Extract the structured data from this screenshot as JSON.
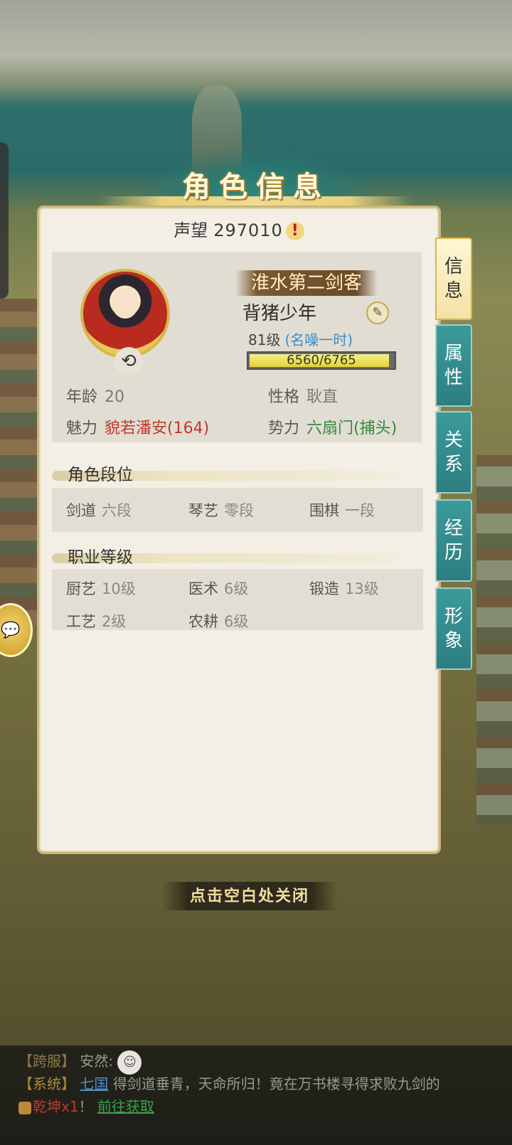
{
  "title": "角色信息",
  "fame": {
    "label": "声望",
    "value": "297010",
    "alert_icon": "exclamation-icon"
  },
  "character": {
    "title_badge": "淮水第二剑客",
    "name": "背猪少年",
    "level": "81级",
    "rank": "(名噪一时)",
    "exp_text": "6560/6765",
    "exp_fraction": 0.97,
    "age_label": "年龄",
    "age": "20",
    "personality_label": "性格",
    "personality": "耿直",
    "charm_label": "魅力",
    "charm": "貌若潘安(164)",
    "faction_label": "势力",
    "faction": "六扇门(捕头)"
  },
  "rank_section": {
    "heading": "角色段位",
    "items": [
      {
        "label": "剑道",
        "value": "六段"
      },
      {
        "label": "琴艺",
        "value": "零段"
      },
      {
        "label": "围棋",
        "value": "一段"
      }
    ]
  },
  "job_section": {
    "heading": "职业等级",
    "items": [
      {
        "label": "厨艺",
        "value": "10级"
      },
      {
        "label": "医术",
        "value": "6级"
      },
      {
        "label": "锻造",
        "value": "13级"
      },
      {
        "label": "工艺",
        "value": "2级"
      },
      {
        "label": "农耕",
        "value": "6级"
      }
    ]
  },
  "side_tabs": [
    {
      "label": "信\n息",
      "active": true
    },
    {
      "label": "属\n性",
      "active": false
    },
    {
      "label": "关\n系",
      "active": false
    },
    {
      "label": "经\n历",
      "active": false
    },
    {
      "label": "形\n象",
      "active": false
    }
  ],
  "close_hint": "点击空白处关闭",
  "chat": {
    "line1": {
      "channel": "【跨服】",
      "name": "安然:",
      "emoji": "ghost-emoji-icon"
    },
    "line2": {
      "channel": "【系统】",
      "player": "七国",
      "text": "得剑道垂青，天命所归！竟在万书楼寻得求败九剑的"
    },
    "line3": {
      "item": "乾坤x1",
      "punct": "！",
      "link": "前往获取"
    }
  },
  "colors": {
    "teal_tab": "#2e7e80",
    "charm_red": "#c0392b",
    "faction_green": "#2e8b3e",
    "rank_blue": "#3d8cc7"
  }
}
